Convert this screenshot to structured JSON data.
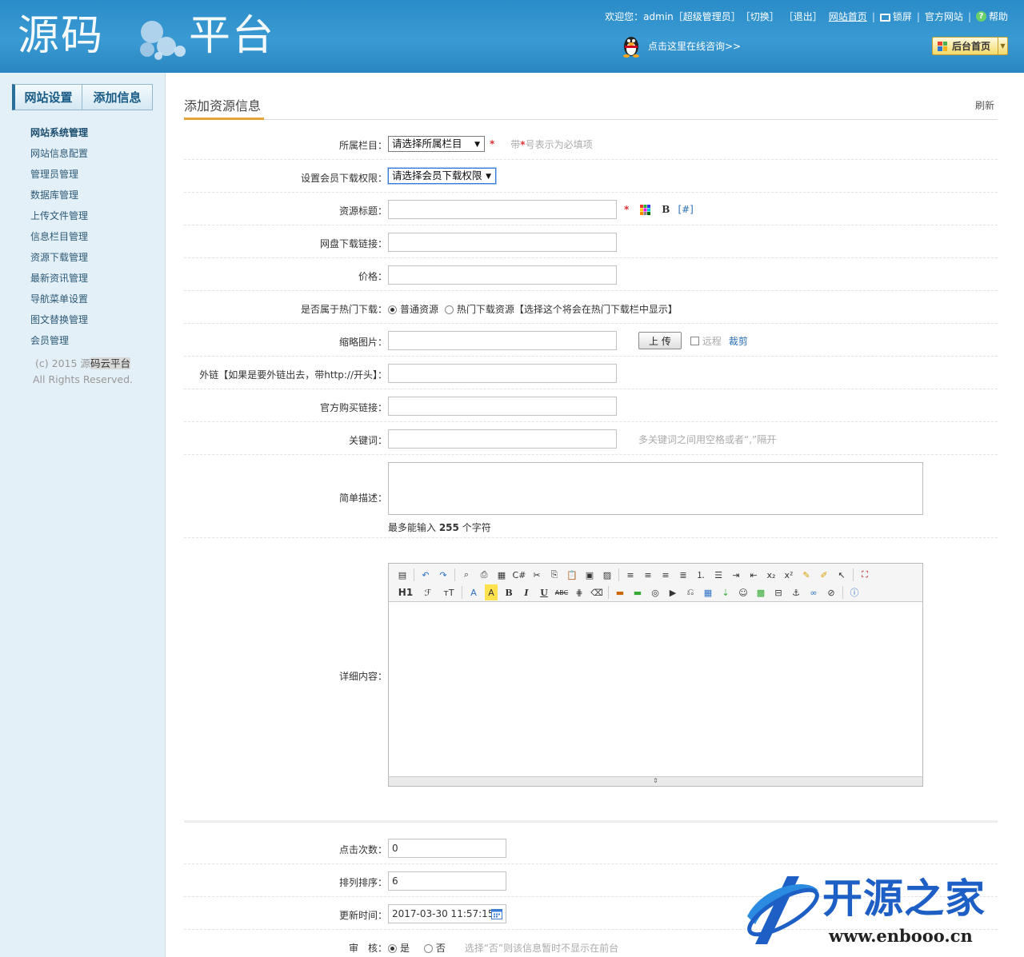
{
  "header": {
    "logo_left": "源码",
    "logo_right": "平台",
    "welcome": "欢迎您：admin［超级管理员］",
    "switch": "［切换］",
    "logout": "［退出］",
    "site_home": "网站首页",
    "lock": "锁屏",
    "official": "官方网站",
    "help": "帮助",
    "consult": "点击这里在线咨询>>",
    "admin_home": "后台首页"
  },
  "sidebar": {
    "tabs": [
      "网站设置",
      "添加信息"
    ],
    "items": [
      {
        "label": "网站系统管理"
      },
      {
        "label": "网站信息配置"
      },
      {
        "label": "管理员管理"
      },
      {
        "label": "数据库管理"
      },
      {
        "label": "上传文件管理"
      },
      {
        "label": "信息栏目管理"
      },
      {
        "label": "资源下载管理"
      },
      {
        "label": "最新资讯管理"
      },
      {
        "label": "导航菜单设置"
      },
      {
        "label": "图文替换管理"
      },
      {
        "label": "会员管理"
      }
    ],
    "copyright_a": "(c) 2015 源",
    "copyright_b": "码云平台",
    "rights": "All Rights Reserved."
  },
  "page": {
    "title": "添加资源信息",
    "refresh": "刷新"
  },
  "form": {
    "category_label": "所属栏目：",
    "category_value": "请选择所属栏目",
    "required_hint_a": "带",
    "required_hint_star": "*",
    "required_hint_b": "号表示为必填项",
    "perm_label": "设置会员下载权限：",
    "perm_value": "请选择会员下载权限",
    "title_label": "资源标题：",
    "title_bold": "B",
    "title_hash": "[#]",
    "netdisk_label": "网盘下载链接：",
    "price_label": "价格：",
    "hot_label": "是否属于热门下载：",
    "hot_opt1": "普通资源",
    "hot_opt2": "热门下载资源【选择这个将会在热门下载栏中显示】",
    "thumb_label": "缩略图片：",
    "upload_btn": "上 传",
    "remote": "远程",
    "crop": "裁剪",
    "ext_label": "外链【如果是要外链出去，带http://开头】：",
    "buy_label": "官方购买链接：",
    "kw_label": "关键词：",
    "kw_hint": "多关键词之间用空格或者“,”隔开",
    "desc_label": "简单描述：",
    "desc_hint_a": "最多能输入 ",
    "desc_hint_num": "255",
    "desc_hint_b": " 个字符",
    "detail_label": "详细内容：",
    "clicks_label": "点击次数：",
    "clicks_value": "0",
    "order_label": "排列排序：",
    "order_value": "6",
    "update_label": "更新时间：",
    "update_value": "2017-03-30 11:57:15",
    "audit_label": "审　核：",
    "audit_yes": "是",
    "audit_no": "否",
    "audit_hint": "选择“否”则该信息暂时不显示在前台"
  },
  "editor": {
    "h1": "H1",
    "font": "ℱ",
    "size": "тT",
    "bold": "B",
    "italic": "I",
    "underline": "U",
    "abc": "ABC"
  },
  "watermark": {
    "brand": "开源之家",
    "url": "www.enbooo.cn"
  }
}
